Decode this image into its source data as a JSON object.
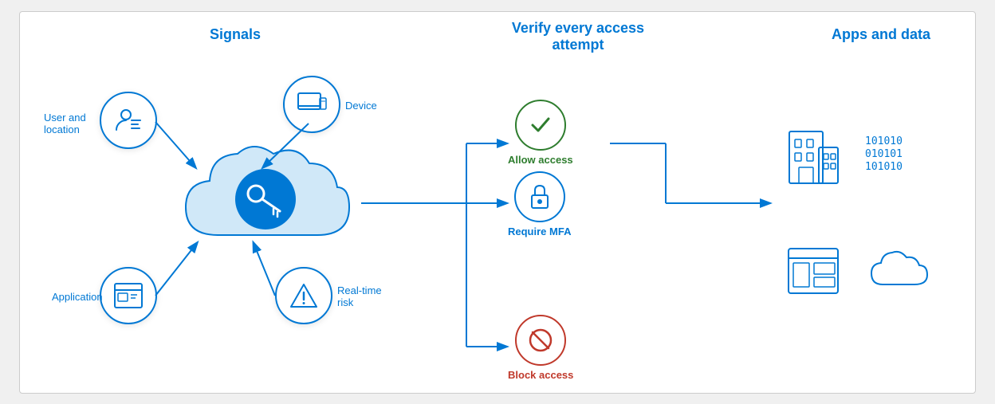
{
  "titles": {
    "signals": "Signals",
    "verify": "Verify every access attempt",
    "apps": "Apps and data"
  },
  "signals": [
    {
      "id": "user-location",
      "label": "User and\nlocation",
      "icon": "user-list"
    },
    {
      "id": "device",
      "label": "Device",
      "icon": "device"
    },
    {
      "id": "application",
      "label": "Application",
      "icon": "app"
    },
    {
      "id": "realtime-risk",
      "label": "Real-time\nrisk",
      "icon": "warning"
    }
  ],
  "outcomes": [
    {
      "id": "allow",
      "label": "Allow access",
      "type": "green",
      "icon": "checkmark"
    },
    {
      "id": "mfa",
      "label": "Require MFA",
      "type": "blue",
      "icon": "lock"
    },
    {
      "id": "block",
      "label": "Block access",
      "type": "red",
      "icon": "no"
    }
  ],
  "cloud": {
    "icon": "key"
  },
  "apps": [
    {
      "id": "building",
      "icon": "building"
    },
    {
      "id": "data-bits",
      "icon": "binary"
    },
    {
      "id": "portal",
      "icon": "portal"
    },
    {
      "id": "cloud-app",
      "icon": "cloud"
    }
  ]
}
